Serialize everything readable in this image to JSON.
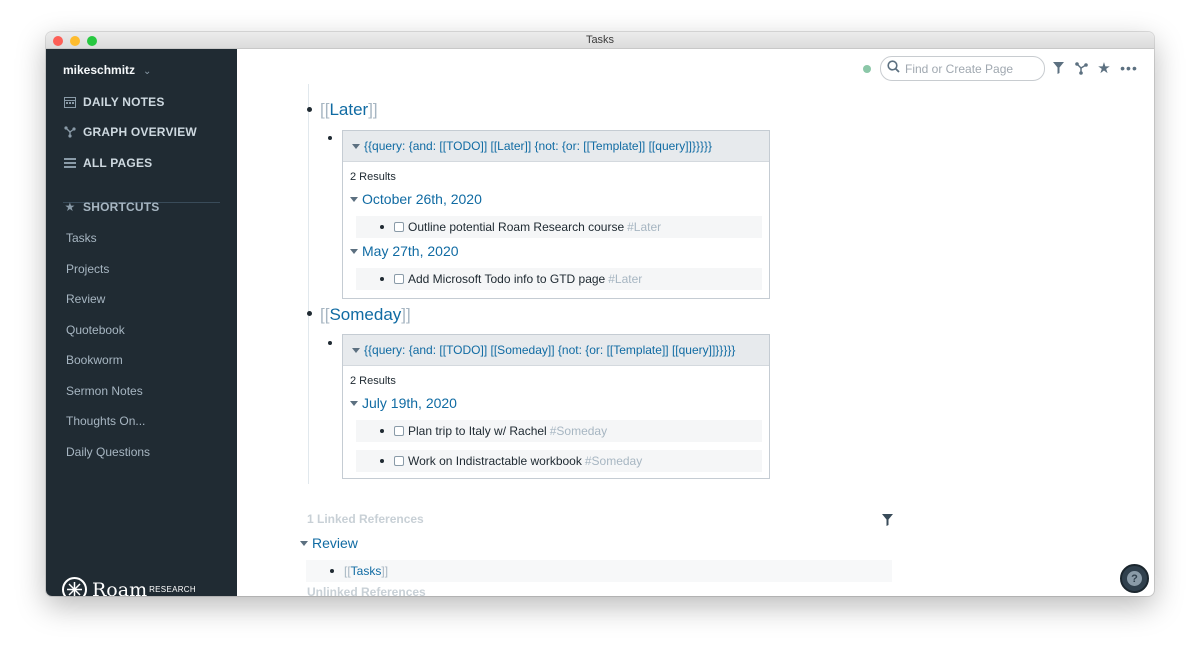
{
  "window": {
    "title": "Tasks"
  },
  "sidebar": {
    "user": "mikeschmitz",
    "nav": [
      {
        "label": "DAILY NOTES",
        "icon": "calendar-icon"
      },
      {
        "label": "GRAPH OVERVIEW",
        "icon": "graph-icon"
      },
      {
        "label": "ALL PAGES",
        "icon": "list-icon"
      }
    ],
    "shortcuts_heading": "SHORTCUTS",
    "shortcuts": [
      "Tasks",
      "Projects",
      "Review",
      "Quotebook",
      "Bookworm",
      "Sermon Notes",
      "Thoughts On...",
      "Daily Questions"
    ],
    "logo_word": "Roam",
    "logo_sub": "RESEARCH"
  },
  "topbar": {
    "search_placeholder": "Find or Create Page",
    "status_color": "#8bc7a8"
  },
  "blocks": [
    {
      "page": "Later",
      "query": "{{query:  {and: [[TODO]] [[Later]] {not: {or: [[Template]] [[query]]}}}}}",
      "results_label": "2 Results",
      "groups": [
        {
          "date": "October 26th, 2020",
          "items": [
            {
              "text": "Outline potential Roam Research course",
              "tag": "#Later"
            }
          ]
        },
        {
          "date": "May 27th, 2020",
          "items": [
            {
              "text": "Add Microsoft Todo info to GTD page",
              "tag": "#Later"
            }
          ]
        }
      ]
    },
    {
      "page": "Someday",
      "query": "{{query:  {and: [[TODO]] [[Someday]] {not: {or: [[Template]] [[query]]}}}}}",
      "results_label": "2 Results",
      "groups": [
        {
          "date": "July 19th, 2020",
          "items": [
            {
              "text": "Plan trip to Italy w/ Rachel",
              "tag": "#Someday"
            },
            {
              "text": "Work on Indistractable workbook",
              "tag": "#Someday"
            }
          ]
        }
      ]
    }
  ],
  "references": {
    "linked_label": "1 Linked References",
    "ref_page": "Review",
    "ref_block": "Tasks",
    "unlinked_label": "Unlinked References"
  },
  "bracket_open": "[[",
  "bracket_close": "]]",
  "help": "?"
}
